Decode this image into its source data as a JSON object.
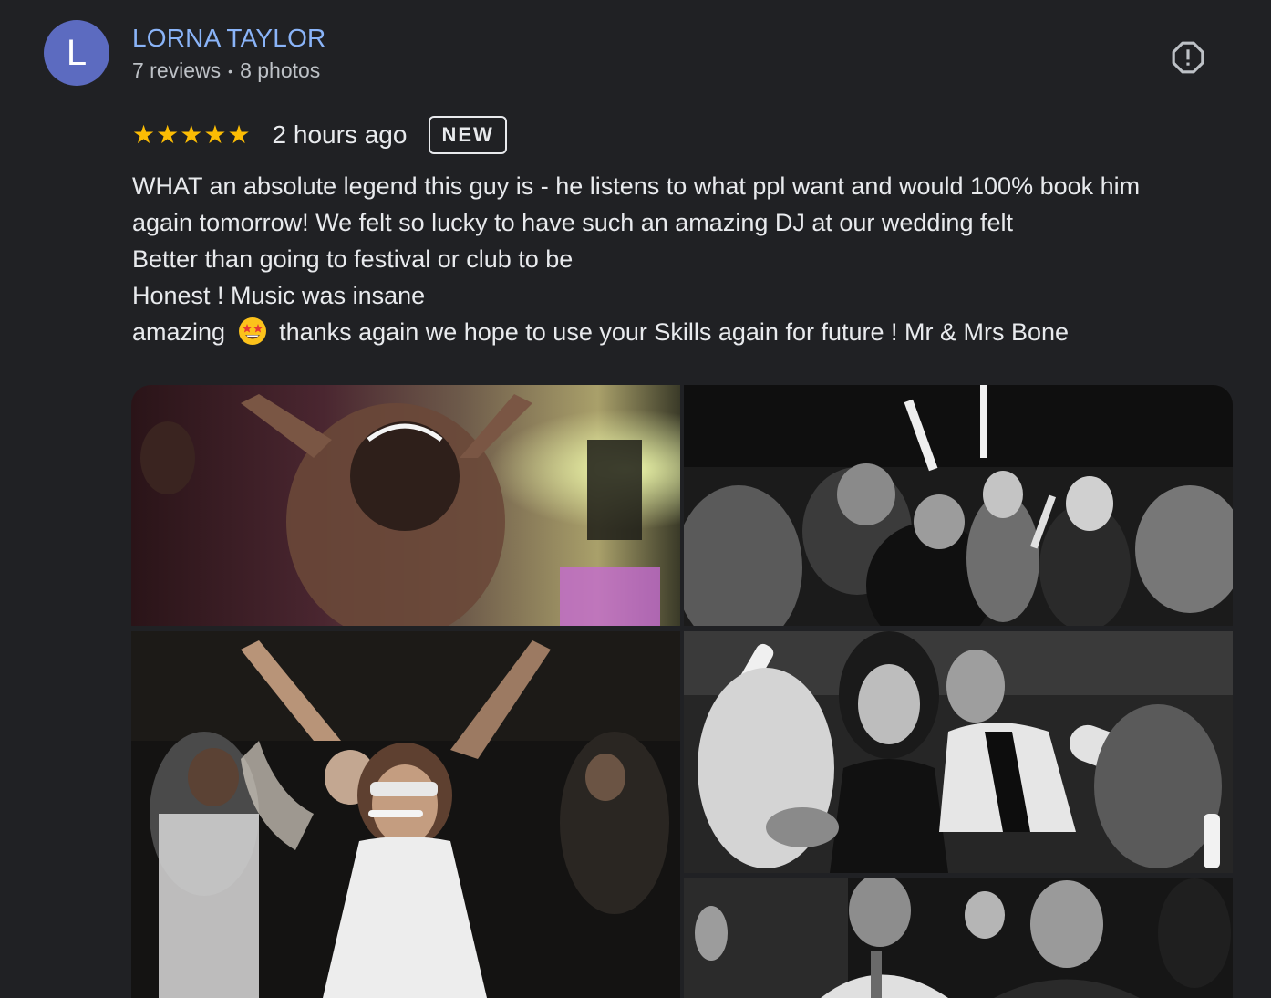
{
  "author": {
    "initial": "L",
    "name": "LORNA TAYLOR",
    "reviews": "7 reviews",
    "photos": "8 photos",
    "avatar_color": "#5c6bc0",
    "name_color": "#8ab4f8"
  },
  "review": {
    "rating": 5,
    "rating_max": 5,
    "time": "2 hours ago",
    "badge": "NEW",
    "star_color": "#fbbc04",
    "text_lines": [
      "WHAT an absolute legend this guy is - he listens to what ppl want and would 100% book him",
      "again tomorrow! We felt so lucky to have such an amazing DJ at our wedding felt",
      "Better than going to festival or club to be",
      "Honest ! Music was insane"
    ],
    "last_line_before_emoji": "amazing",
    "emoji": "star-struck-emoji",
    "last_line_after_emoji": "thanks again we hope to use your Skills again for future ! Mr & Mrs Bone"
  },
  "icons": {
    "report": "report-icon",
    "star": "star-icon"
  },
  "photos": [
    {
      "name": "photo-bride-dancing",
      "scene": "color"
    },
    {
      "name": "photo-guests-glowsticks",
      "scene": "bw"
    },
    {
      "name": "photo-woman-sunglasses",
      "scene": "dark"
    },
    {
      "name": "photo-couple-dancing",
      "scene": "bw"
    },
    {
      "name": "photo-men-cheering",
      "scene": "dark"
    }
  ],
  "colors": {
    "background": "#202124",
    "text": "#e8eaed",
    "secondary_text": "#bdc1c6"
  }
}
